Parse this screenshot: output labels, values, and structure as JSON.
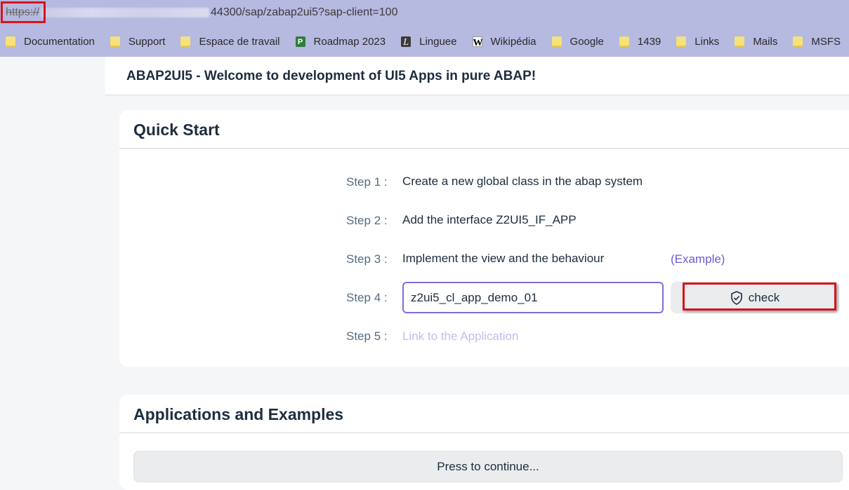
{
  "browser": {
    "url_protocol": "https://",
    "url_rest": "44300/sap/zabap2ui5?sap-client=100",
    "bookmarks": [
      {
        "label": "Documentation",
        "icon": "folder-icon"
      },
      {
        "label": "Support",
        "icon": "folder-icon"
      },
      {
        "label": "Espace de travail",
        "icon": "folder-icon"
      },
      {
        "label": "Roadmap 2023",
        "icon": "project-icon"
      },
      {
        "label": "Linguee",
        "icon": "linguee-icon"
      },
      {
        "label": "Wikipédia",
        "icon": "wikipedia-icon"
      },
      {
        "label": "Google",
        "icon": "folder-icon"
      },
      {
        "label": "1439",
        "icon": "folder-icon"
      },
      {
        "label": "Links",
        "icon": "folder-icon"
      },
      {
        "label": "Mails",
        "icon": "folder-icon"
      },
      {
        "label": "MSFS",
        "icon": "folder-icon"
      }
    ]
  },
  "page": {
    "title": "ABAP2UI5 - Welcome to development of UI5 Apps in pure ABAP!"
  },
  "quick_start": {
    "title": "Quick Start",
    "steps": [
      {
        "label": "Step 1 :",
        "text": "Create a new global class in the abap system"
      },
      {
        "label": "Step 2 :",
        "text": "Add the interface Z2UI5_IF_APP"
      },
      {
        "label": "Step 3 :",
        "text": "Implement the view and the behaviour",
        "link": "(Example)"
      },
      {
        "label": "Step 4 :",
        "input_value": "z2ui5_cl_app_demo_01",
        "button": "check"
      },
      {
        "label": "Step 5 :",
        "link": "Link to the Application"
      }
    ]
  },
  "applications": {
    "title": "Applications and Examples",
    "button": "Press to continue..."
  },
  "colors": {
    "browser_bar": "#b6b9e0",
    "highlight": "#d9141b",
    "link": "#6b5bd6"
  }
}
